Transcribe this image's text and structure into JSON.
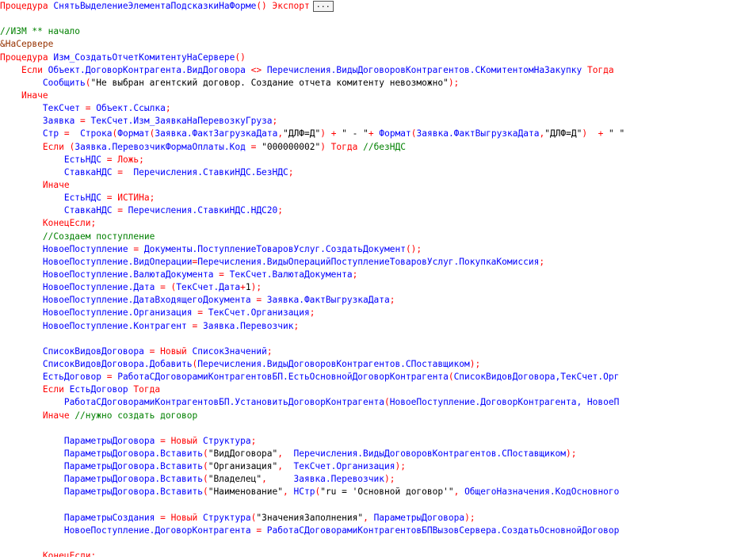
{
  "lines": [
    [
      [
        "k",
        "Процедура "
      ],
      [
        "t",
        "СнятьВыделениеЭлементаПодсказкиНаФорме"
      ],
      [
        "o",
        "() "
      ],
      [
        "k",
        "Экспорт"
      ]
    ],
    [],
    [
      [
        "c",
        "//ИЗМ ** начало"
      ]
    ],
    [
      [
        "p",
        "&НаСервере"
      ]
    ],
    [
      [
        "k",
        "Процедура "
      ],
      [
        "t",
        "Изм_СоздатьОтчетКомитентуНаСервере"
      ],
      [
        "o",
        "()"
      ]
    ],
    [
      [
        "s",
        "    "
      ],
      [
        "k",
        "Если "
      ],
      [
        "t",
        "Объект.ДоговорКонтрагента.ВидДоговора "
      ],
      [
        "o",
        "<> "
      ],
      [
        "t",
        "Перечисления.ВидыДоговоровКонтрагентов.СКомитентомНаЗакупку "
      ],
      [
        "k",
        "Тогда"
      ]
    ],
    [
      [
        "s",
        "        "
      ],
      [
        "t",
        "Сообщить"
      ],
      [
        "o",
        "("
      ],
      [
        "s",
        "\"Не выбран агентский договор. Создание отчета комитенту невозможно\""
      ],
      [
        "o",
        ");"
      ]
    ],
    [
      [
        "s",
        "    "
      ],
      [
        "k",
        "Иначе"
      ]
    ],
    [
      [
        "s",
        "        "
      ],
      [
        "t",
        "ТекСчет "
      ],
      [
        "o",
        "= "
      ],
      [
        "t",
        "Объект.Ссылка"
      ],
      [
        "o",
        ";"
      ]
    ],
    [
      [
        "s",
        "        "
      ],
      [
        "t",
        "Заявка "
      ],
      [
        "o",
        "= "
      ],
      [
        "t",
        "ТекСчет.Изм_ЗаявкаНаПеревозкуГруза"
      ],
      [
        "o",
        ";"
      ]
    ],
    [
      [
        "s",
        "        "
      ],
      [
        "t",
        "Стр "
      ],
      [
        "o",
        "=  "
      ],
      [
        "t",
        "Строка"
      ],
      [
        "o",
        "("
      ],
      [
        "t",
        "Формат"
      ],
      [
        "o",
        "("
      ],
      [
        "t",
        "Заявка.ФактЗагрузкаДата"
      ],
      [
        "o",
        ","
      ],
      [
        "s",
        "\"ДЛФ=Д\""
      ],
      [
        "o",
        ") + "
      ],
      [
        "s",
        "\" - \""
      ],
      [
        "o",
        "+ "
      ],
      [
        "t",
        "Формат"
      ],
      [
        "o",
        "("
      ],
      [
        "t",
        "Заявка.ФактВыгрузкаДата"
      ],
      [
        "o",
        ","
      ],
      [
        "s",
        "\"ДЛФ=Д\""
      ],
      [
        "o",
        ")  + "
      ],
      [
        "s",
        "\" \""
      ]
    ],
    [
      [
        "s",
        "        "
      ],
      [
        "k",
        "Если "
      ],
      [
        "o",
        "("
      ],
      [
        "t",
        "Заявка.ПеревозчикФормаОплаты.Код "
      ],
      [
        "o",
        "= "
      ],
      [
        "s",
        "\"000000002\""
      ],
      [
        "o",
        ") "
      ],
      [
        "k",
        "Тогда "
      ],
      [
        "c",
        "//безНДС"
      ]
    ],
    [
      [
        "s",
        "            "
      ],
      [
        "t",
        "ЕстьНДС "
      ],
      [
        "o",
        "= "
      ],
      [
        "k",
        "Ложь"
      ],
      [
        "o",
        ";"
      ]
    ],
    [
      [
        "s",
        "            "
      ],
      [
        "t",
        "СтавкаНДС "
      ],
      [
        "o",
        "=  "
      ],
      [
        "t",
        "Перечисления.СтавкиНДС.БезНДС"
      ],
      [
        "o",
        ";"
      ]
    ],
    [
      [
        "s",
        "        "
      ],
      [
        "k",
        "Иначе"
      ]
    ],
    [
      [
        "s",
        "            "
      ],
      [
        "t",
        "ЕстьНДС "
      ],
      [
        "o",
        "= "
      ],
      [
        "k",
        "ИСТИНа"
      ],
      [
        "o",
        ";"
      ]
    ],
    [
      [
        "s",
        "            "
      ],
      [
        "t",
        "СтавкаНДС "
      ],
      [
        "o",
        "= "
      ],
      [
        "t",
        "Перечисления.СтавкиНДС.НДС20"
      ],
      [
        "o",
        ";"
      ]
    ],
    [
      [
        "s",
        "        "
      ],
      [
        "k",
        "КонецЕсли"
      ],
      [
        "o",
        ";"
      ]
    ],
    [
      [
        "s",
        "        "
      ],
      [
        "c",
        "//Создаем поступление"
      ]
    ],
    [
      [
        "s",
        "        "
      ],
      [
        "t",
        "НовоеПоступление "
      ],
      [
        "o",
        "= "
      ],
      [
        "t",
        "Документы.ПоступлениеТоваровУслуг.СоздатьДокумент"
      ],
      [
        "o",
        "();"
      ]
    ],
    [
      [
        "s",
        "        "
      ],
      [
        "t",
        "НовоеПоступление.ВидОперации"
      ],
      [
        "o",
        "="
      ],
      [
        "t",
        "Перечисления.ВидыОперацийПоступлениеТоваровУслуг.ПокупкаКомиссия"
      ],
      [
        "o",
        ";"
      ]
    ],
    [
      [
        "s",
        "        "
      ],
      [
        "t",
        "НовоеПоступление.ВалютаДокумента "
      ],
      [
        "o",
        "= "
      ],
      [
        "t",
        "ТекСчет.ВалютаДокумента"
      ],
      [
        "o",
        ";"
      ]
    ],
    [
      [
        "s",
        "        "
      ],
      [
        "t",
        "НовоеПоступление.Дата "
      ],
      [
        "o",
        "= ("
      ],
      [
        "t",
        "ТекСчет.Дата"
      ],
      [
        "o",
        "+"
      ],
      [
        "s",
        "1"
      ],
      [
        "o",
        ");"
      ]
    ],
    [
      [
        "s",
        "        "
      ],
      [
        "t",
        "НовоеПоступление.ДатаВходящегоДокумента "
      ],
      [
        "o",
        "= "
      ],
      [
        "t",
        "Заявка.ФактВыгрузкаДата"
      ],
      [
        "o",
        ";"
      ]
    ],
    [
      [
        "s",
        "        "
      ],
      [
        "t",
        "НовоеПоступление.Организация "
      ],
      [
        "o",
        "= "
      ],
      [
        "t",
        "ТекСчет.Организация"
      ],
      [
        "o",
        ";"
      ]
    ],
    [
      [
        "s",
        "        "
      ],
      [
        "t",
        "НовоеПоступление.Контрагент "
      ],
      [
        "o",
        "= "
      ],
      [
        "t",
        "Заявка.Перевозчик"
      ],
      [
        "o",
        ";"
      ]
    ],
    [],
    [
      [
        "s",
        "        "
      ],
      [
        "t",
        "СписокВидовДоговора "
      ],
      [
        "o",
        "= "
      ],
      [
        "k",
        "Новый "
      ],
      [
        "t",
        "СписокЗначений"
      ],
      [
        "o",
        ";"
      ]
    ],
    [
      [
        "s",
        "        "
      ],
      [
        "t",
        "СписокВидовДоговора.Добавить"
      ],
      [
        "o",
        "("
      ],
      [
        "t",
        "Перечисления.ВидыДоговоровКонтрагентов.СПоставщиком"
      ],
      [
        "o",
        ");"
      ]
    ],
    [
      [
        "s",
        "        "
      ],
      [
        "t",
        "ЕстьДоговор "
      ],
      [
        "o",
        "= "
      ],
      [
        "t",
        "РаботаСДоговорамиКонтрагентовБП.ЕстьОсновнойДоговорКонтрагента"
      ],
      [
        "o",
        "("
      ],
      [
        "t",
        "СписокВидовДоговора,ТекСчет.Орг"
      ]
    ],
    [
      [
        "s",
        "        "
      ],
      [
        "k",
        "Если "
      ],
      [
        "t",
        "ЕстьДоговор "
      ],
      [
        "k",
        "Тогда"
      ]
    ],
    [
      [
        "s",
        "            "
      ],
      [
        "t",
        "РаботаСДоговорамиКонтрагентовБП.УстановитьДоговорКонтрагента"
      ],
      [
        "o",
        "("
      ],
      [
        "t",
        "НовоеПоступление.ДоговорКонтрагента, НовоеП"
      ]
    ],
    [
      [
        "s",
        "        "
      ],
      [
        "k",
        "Иначе "
      ],
      [
        "c",
        "//нужно создать договор"
      ]
    ],
    [],
    [
      [
        "s",
        "            "
      ],
      [
        "t",
        "ПараметрыДоговора "
      ],
      [
        "o",
        "= "
      ],
      [
        "k",
        "Новый "
      ],
      [
        "t",
        "Структура"
      ],
      [
        "o",
        ";"
      ]
    ],
    [
      [
        "s",
        "            "
      ],
      [
        "t",
        "ПараметрыДоговора.Вставить"
      ],
      [
        "o",
        "("
      ],
      [
        "s",
        "\"ВидДоговора\""
      ],
      [
        "o",
        ",  "
      ],
      [
        "t",
        "Перечисления.ВидыДоговоровКонтрагентов.СПоставщиком"
      ],
      [
        "o",
        ");"
      ]
    ],
    [
      [
        "s",
        "            "
      ],
      [
        "t",
        "ПараметрыДоговора.Вставить"
      ],
      [
        "o",
        "("
      ],
      [
        "s",
        "\"Организация\""
      ],
      [
        "o",
        ",  "
      ],
      [
        "t",
        "ТекСчет.Организация"
      ],
      [
        "o",
        ");"
      ]
    ],
    [
      [
        "s",
        "            "
      ],
      [
        "t",
        "ПараметрыДоговора.Вставить"
      ],
      [
        "o",
        "("
      ],
      [
        "s",
        "\"Владелец\""
      ],
      [
        "o",
        ",     "
      ],
      [
        "t",
        "Заявка.Перевозчик"
      ],
      [
        "o",
        ");"
      ]
    ],
    [
      [
        "s",
        "            "
      ],
      [
        "t",
        "ПараметрыДоговора.Вставить"
      ],
      [
        "o",
        "("
      ],
      [
        "s",
        "\"Наименование\""
      ],
      [
        "o",
        ", "
      ],
      [
        "t",
        "НСтр"
      ],
      [
        "o",
        "("
      ],
      [
        "s",
        "\"ru = 'Основной договор'\""
      ],
      [
        "o",
        ", "
      ],
      [
        "t",
        "ОбщегоНазначения.КодОсновного"
      ]
    ],
    [],
    [
      [
        "s",
        "            "
      ],
      [
        "t",
        "ПараметрыСоздания "
      ],
      [
        "o",
        "= "
      ],
      [
        "k",
        "Новый "
      ],
      [
        "t",
        "Структура"
      ],
      [
        "o",
        "("
      ],
      [
        "s",
        "\"ЗначенияЗаполнения\""
      ],
      [
        "o",
        ", "
      ],
      [
        "t",
        "ПараметрыДоговора"
      ],
      [
        "o",
        ");"
      ]
    ],
    [
      [
        "s",
        "            "
      ],
      [
        "t",
        "НовоеПоступление.ДоговорКонтрагента "
      ],
      [
        "o",
        "= "
      ],
      [
        "t",
        "РаботаСДоговорамиКонтрагентовБПВызовСервера.СоздатьОсновнойДоговор"
      ]
    ],
    [],
    [
      [
        "s",
        "        "
      ],
      [
        "k",
        "КонецЕсли"
      ],
      [
        "o",
        ";"
      ]
    ]
  ],
  "ellipsis_button": {
    "label": "..."
  }
}
